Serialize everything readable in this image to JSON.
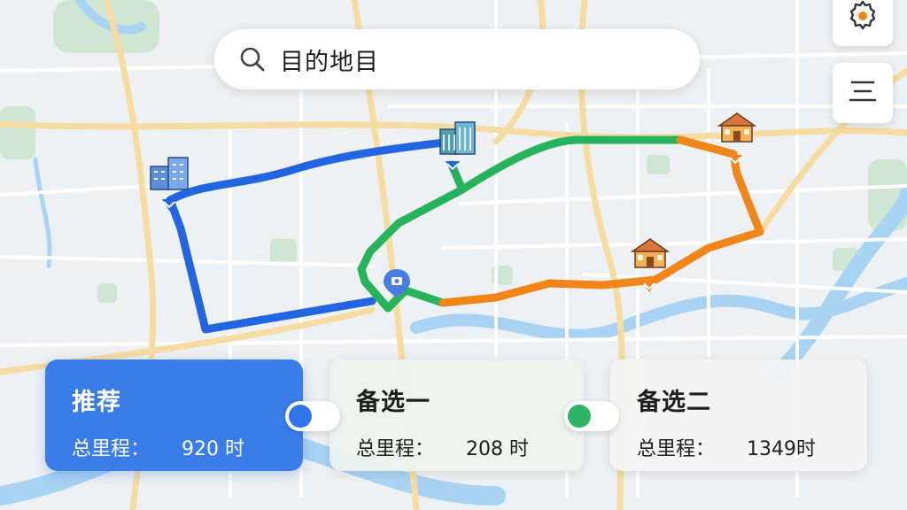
{
  "search": {
    "query": "目的地目",
    "icon": "search-icon"
  },
  "buttons": {
    "settings_icon": "gear-icon",
    "menu_icon": "menu-icon"
  },
  "routes": [
    {
      "title": "推荐",
      "label": "总里程：",
      "value": "920 时",
      "selected": true,
      "color": "#3a7de8"
    },
    {
      "title": "备选一",
      "label": "总里程：",
      "value": "208 时",
      "selected": false,
      "color": "#2fb562"
    },
    {
      "title": "备选二",
      "label": "总里程：",
      "value": "1349时",
      "selected": false,
      "color": "#f0851e"
    }
  ],
  "colors": {
    "route_blue": "#2166e0",
    "route_green": "#27b35c",
    "route_orange": "#f08519",
    "accent": "#3a7de8"
  }
}
